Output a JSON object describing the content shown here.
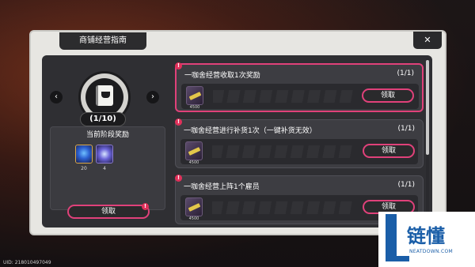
{
  "window": {
    "title": "商铺经营指南",
    "close_label": "✕"
  },
  "stage": {
    "progress": "(1/10)",
    "rewards_title": "当前阶段奖励",
    "rewards": [
      {
        "icon": "blue-crystal-icon",
        "count": "20"
      },
      {
        "icon": "purple-orb-icon",
        "count": "4"
      }
    ],
    "claim_label": "领取",
    "prev_label": "‹",
    "next_label": "›"
  },
  "tasks": [
    {
      "title": "一咖舍经营收取1次奖励",
      "progress": "(1/1)",
      "item_icon": "gold-ticket-icon",
      "item_count": "4500",
      "claim_label": "领取",
      "active": true
    },
    {
      "title": "一咖舍经营进行补货1次（一键补货无效）",
      "progress": "(1/1)",
      "item_icon": "gold-ticket-icon",
      "item_count": "4500",
      "claim_label": "领取",
      "active": false
    },
    {
      "title": "一咖舍经营上阵1个雇员",
      "progress": "(1/1)",
      "item_icon": "gold-ticket-icon",
      "item_count": "4500",
      "claim_label": "领取",
      "active": false
    }
  ],
  "footer": {
    "uid": "UID: 218010497049"
  },
  "watermark": {
    "brand": "链懂",
    "site": "NEATDOWN.COM"
  },
  "colors": {
    "accent": "#e0417a",
    "panel": "#e7e6e2",
    "inner": "#2f2f33"
  }
}
